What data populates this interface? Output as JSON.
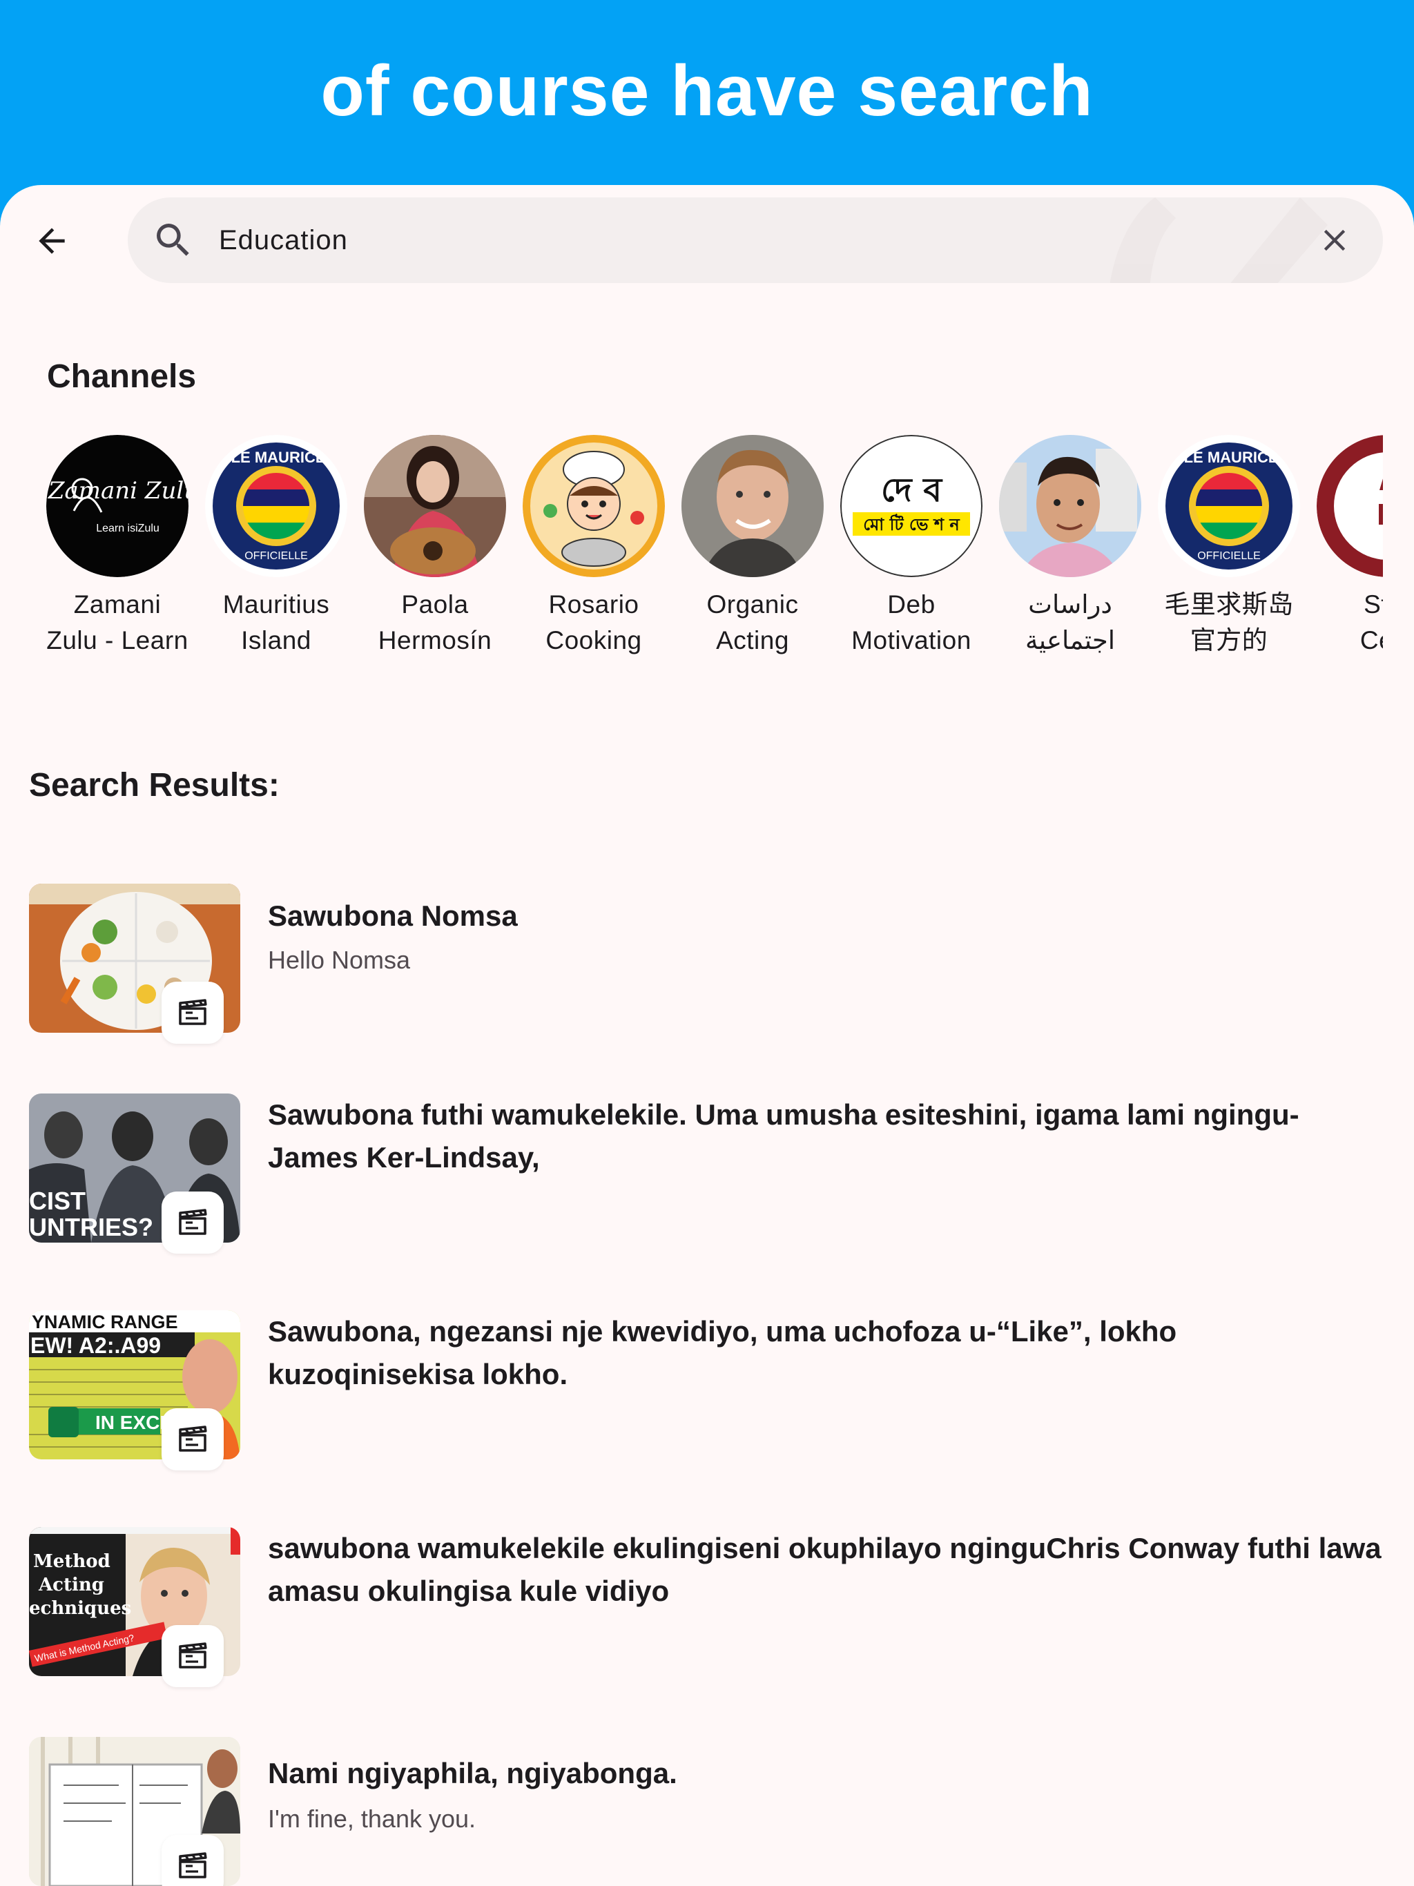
{
  "banner": {
    "title": "of course have search"
  },
  "search": {
    "value": "Education"
  },
  "channels_section": {
    "title": "Channels",
    "items": [
      {
        "name": "Zamani\nZulu - Learn",
        "avatar_text": "Zamani Zulu",
        "avatar_sub": "Learn isiZulu"
      },
      {
        "name": "Mauritius\nIsland",
        "avatar_text": "ILE MAURICE",
        "avatar_sub": "OFFICIELLE"
      },
      {
        "name": "Paola\nHermosín"
      },
      {
        "name": "Rosario\nCooking"
      },
      {
        "name": "Organic\nActing"
      },
      {
        "name": "Deb\nMotivation",
        "avatar_text": "দে ব",
        "avatar_sub": "মো টি ভে শ ন"
      },
      {
        "name": "دراسات\nاجتماعية"
      },
      {
        "name": "毛里求斯岛\n官方的",
        "avatar_text": "ILE MAURICE",
        "avatar_sub": "OFFICIELLE"
      },
      {
        "name": "Star\nCent"
      }
    ]
  },
  "results_section": {
    "title": "Search Results:",
    "items": [
      {
        "title": "Sawubona Nomsa",
        "subtitle": "Hello Nomsa"
      },
      {
        "title": "Sawubona futhi wamukelekile. Uma umusha esiteshini, igama lami ngingu-James Ker-Lindsay,",
        "subtitle": "",
        "thumb_text": [
          "CIST",
          "UNTRIES?"
        ]
      },
      {
        "title": "Sawubona, ngezansi nje kwevidiyo, uma uchofoza u-“Like”, lokho kuzoqinisekisa lokho.",
        "subtitle": "",
        "thumb_text": [
          "YNAMIC RANGE",
          "EW! A2:.A99",
          "IN EXCE"
        ]
      },
      {
        "title": "sawubona wamukelekile ekulingiseni okuphilayo nginguChris Conway futhi lawa amasu okulingisa kule vidiyo",
        "subtitle": "",
        "thumb_text": [
          "Method",
          "Acting",
          "echniques",
          "What is Method Acting?"
        ]
      },
      {
        "title": "Nami ngiyaphila, ngiyabonga.",
        "subtitle": "I'm fine, thank you."
      }
    ]
  },
  "colors": {
    "banner": "#03a2f5",
    "background": "#fff8f8",
    "search_bar": "#f3eeee"
  }
}
